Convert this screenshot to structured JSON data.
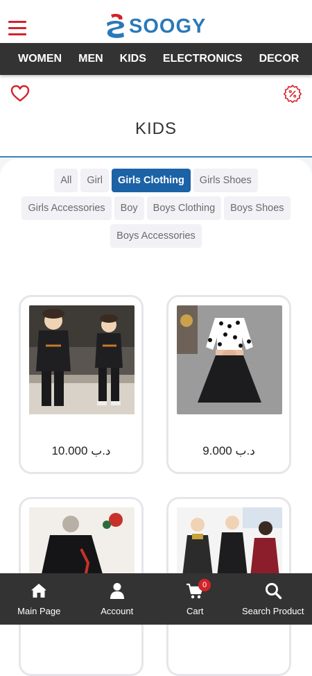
{
  "brand": {
    "name": "SOOGY"
  },
  "nav": {
    "items": [
      "WOMEN",
      "MEN",
      "KIDS",
      "ELECTRONICS",
      "DECOR"
    ]
  },
  "page": {
    "title": "KIDS"
  },
  "filters": {
    "active": "Girls Clothing",
    "items": [
      "All",
      "Girl",
      "Girls Clothing",
      "Girls Shoes",
      "Girls Accessories",
      "Boy",
      "Boys Clothing",
      "Boys Shoes",
      "Boys Accessories"
    ]
  },
  "products": [
    {
      "price": "10.000 د.ب"
    },
    {
      "price": "9.000 د.ب"
    },
    {
      "price": ""
    },
    {
      "price": ""
    }
  ],
  "bottom_nav": {
    "items": [
      {
        "label": "Main Page",
        "icon": "home-icon"
      },
      {
        "label": "Account",
        "icon": "user-icon"
      },
      {
        "label": "Cart",
        "icon": "cart-icon"
      },
      {
        "label": "Search Product",
        "icon": "search-icon"
      }
    ],
    "cart_count": "0"
  },
  "colors": {
    "brand_blue": "#2a79b8",
    "brand_red": "#d3222a",
    "active_chip": "#1c62a6",
    "bar_dark": "#333333"
  }
}
